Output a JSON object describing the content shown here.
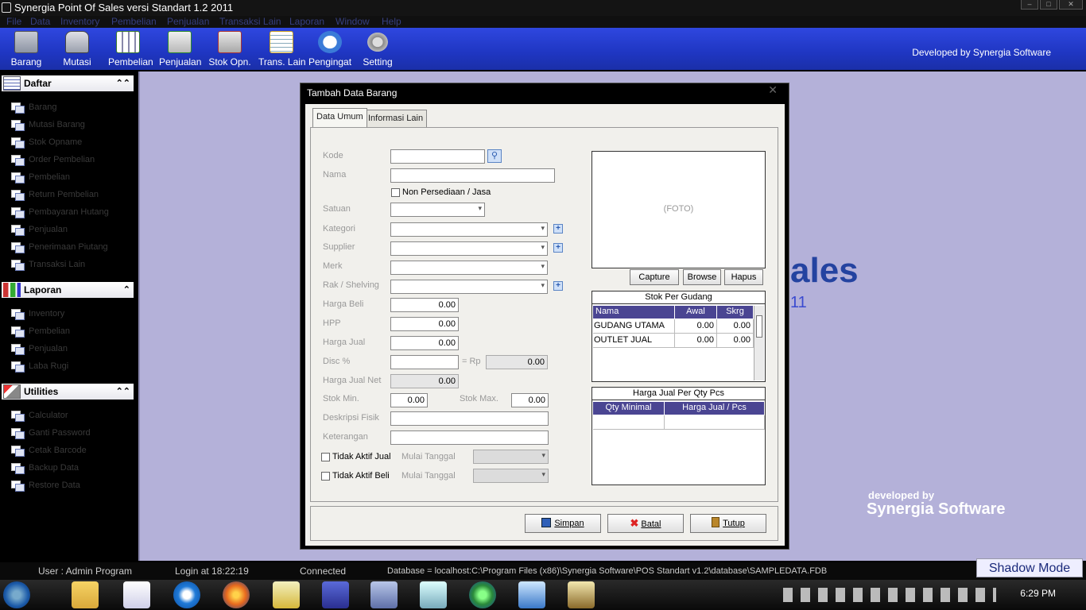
{
  "window": {
    "title": "Synergia Point Of Sales versi Standart 1.2 2011"
  },
  "menu": [
    "File",
    "Data",
    "Inventory",
    "Pembelian",
    "Penjualan",
    "Transaksi Lain",
    "Laporan",
    "Window",
    "Help"
  ],
  "toolbar": {
    "buttons": [
      {
        "label": "Barang",
        "icon": "box-icon"
      },
      {
        "label": "Mutasi",
        "icon": "car-icon"
      },
      {
        "label": "Pembelian",
        "icon": "calculator-icon"
      },
      {
        "label": "Penjualan",
        "icon": "cart-icon"
      },
      {
        "label": "Stok Opn.",
        "icon": "stock-icon"
      },
      {
        "label": "Trans. Lain",
        "icon": "notepad-icon"
      },
      {
        "label": "Pengingat",
        "icon": "alarm-clock-icon"
      },
      {
        "label": "Setting",
        "icon": "gear-icon"
      }
    ],
    "developed_by": "Developed by Synergia Software"
  },
  "sidebar": {
    "daftar": {
      "title": "Daftar",
      "items": [
        "Barang",
        "Mutasi Barang",
        "Stok Opname",
        "Order Pembelian",
        "Pembelian",
        "Return Pembelian",
        "Pembayaran Hutang",
        "Penjualan",
        "Penerimaan Piutang",
        "Transaksi Lain"
      ]
    },
    "laporan": {
      "title": "Laporan",
      "items": [
        "Inventory",
        "Pembelian",
        "Penjualan",
        "Laba Rugi"
      ]
    },
    "utilities": {
      "title": "Utilities",
      "items": [
        "Calculator",
        "Ganti Password",
        "Cetak Barcode",
        "Backup Data",
        "Restore Data"
      ]
    }
  },
  "background": {
    "logo_fragment": "ales",
    "version_fragment": "11",
    "devby_small": "developed by",
    "devby_big": "Synergia Software"
  },
  "dialog": {
    "title": "Tambah Data Barang",
    "tabs": [
      "Data Umum",
      "Informasi Lain"
    ],
    "labels": {
      "kode": "Kode",
      "nama": "Nama",
      "non_persediaan": "Non Persediaan / Jasa",
      "satuan": "Satuan",
      "kategori": "Kategori",
      "supplier": "Supplier",
      "merk": "Merk",
      "rak": "Rak / Shelving",
      "harga_beli": "Harga Beli",
      "hpp": "HPP",
      "harga_jual": "Harga Jual",
      "disc": "Disc %",
      "rp": "= Rp",
      "harga_jual_net": "Harga Jual Net",
      "stok_min": "Stok Min.",
      "stok_max": "Stok Max.",
      "deskripsi_fisik": "Deskripsi Fisik",
      "keterangan": "Keterangan",
      "tidak_aktif_jual": "Tidak Aktif Jual",
      "tidak_aktif_beli": "Tidak Aktif Beli",
      "mulai_tanggal": "Mulai Tanggal"
    },
    "values": {
      "harga_beli": "0.00",
      "hpp": "0.00",
      "harga_jual": "0.00",
      "disc_rp": "0.00",
      "harga_jual_net": "0.00",
      "stok_min": "0.00",
      "stok_max": "0.00"
    },
    "photo": {
      "placeholder": "(FOTO)",
      "capture": "Capture",
      "browse": "Browse",
      "hapus": "Hapus"
    },
    "stok_gudang": {
      "title": "Stok Per Gudang",
      "columns": [
        "Nama",
        "Awal",
        "Skrg"
      ],
      "rows": [
        [
          "GUDANG UTAMA",
          "0.00",
          "0.00"
        ],
        [
          "OUTLET JUAL",
          "0.00",
          "0.00"
        ]
      ]
    },
    "harga_qty": {
      "title": "Harga Jual Per Qty Pcs",
      "columns": [
        "Qty Minimal",
        "Harga Jual / Pcs"
      ]
    },
    "buttons": {
      "simpan": "Simpan",
      "batal": "Batal",
      "tutup": "Tutup"
    }
  },
  "status": {
    "user": "User : Admin Program",
    "login": "Login at 18:22:19",
    "connected": "Connected",
    "database": "Database = localhost:C:\\Program Files (x86)\\Synergia Software\\POS Standart v1.2\\database\\SAMPLEDATA.FDB",
    "shadow_mode": "Shadow Mode"
  },
  "taskbar": {
    "clock": "6:29 PM"
  },
  "colors": {
    "toolbar": "#2b43d6",
    "desktop": "#b4b1d9",
    "grid_header": "#4a4592"
  }
}
